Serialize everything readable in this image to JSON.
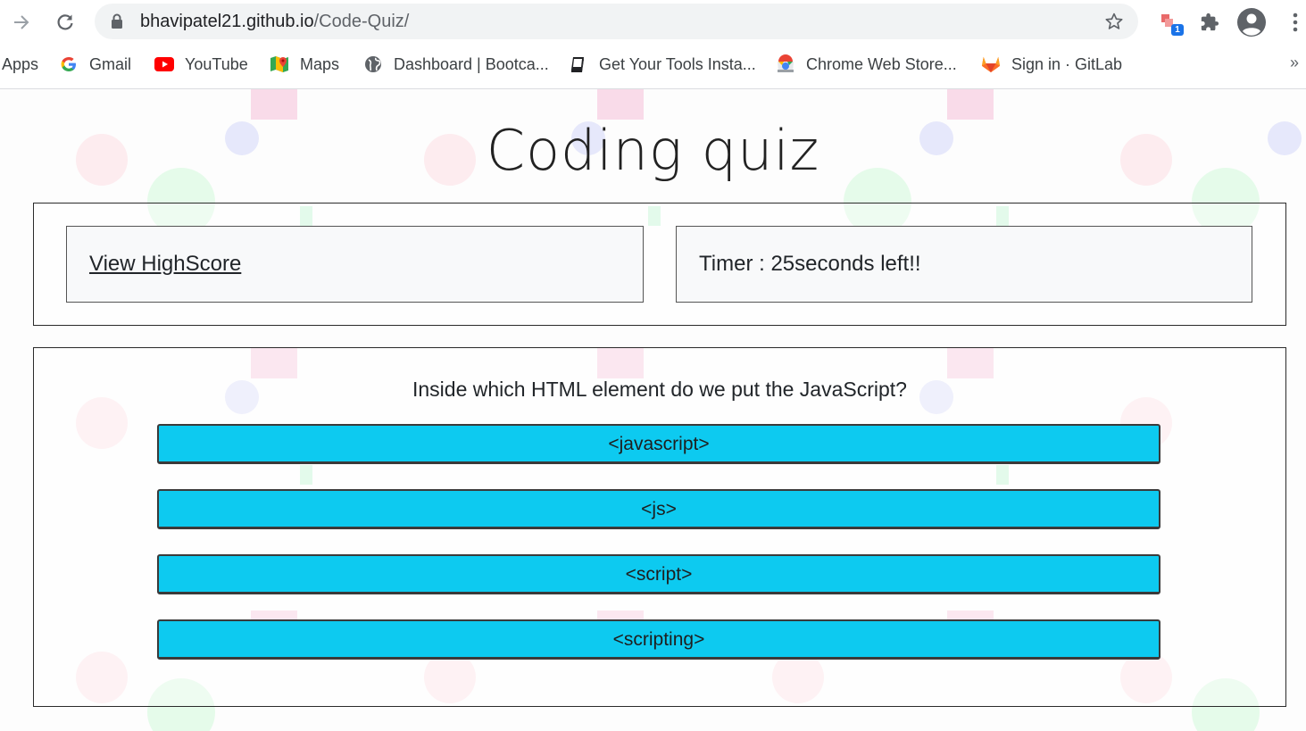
{
  "browser": {
    "url_host": "bhavipatel21.github.io",
    "url_path": "/Code-Quiz/",
    "extension_badge": "1",
    "bookmarks": [
      {
        "label": "Apps",
        "icon": "apps-icon"
      },
      {
        "label": "Gmail",
        "icon": "google-icon"
      },
      {
        "label": "YouTube",
        "icon": "youtube-icon"
      },
      {
        "label": "Maps",
        "icon": "maps-icon"
      },
      {
        "label": "Dashboard | Bootca...",
        "icon": "globe-icon"
      },
      {
        "label": "Get Your Tools Insta...",
        "icon": "book-icon"
      },
      {
        "label": "Chrome Web Store...",
        "icon": "chrome-web-store-icon"
      },
      {
        "label": "Sign in · GitLab",
        "icon": "gitlab-icon"
      }
    ],
    "more_label": "»"
  },
  "page": {
    "title": "Coding quiz",
    "highscore_link": "View HighScore",
    "timer_text": "Timer : 25seconds left!!",
    "question": "Inside which HTML element do we put the JavaScript?",
    "answers": [
      "<javascript>",
      "<js>",
      "<script>",
      "<scripting>"
    ],
    "answer_color": "#0dcaf0"
  }
}
